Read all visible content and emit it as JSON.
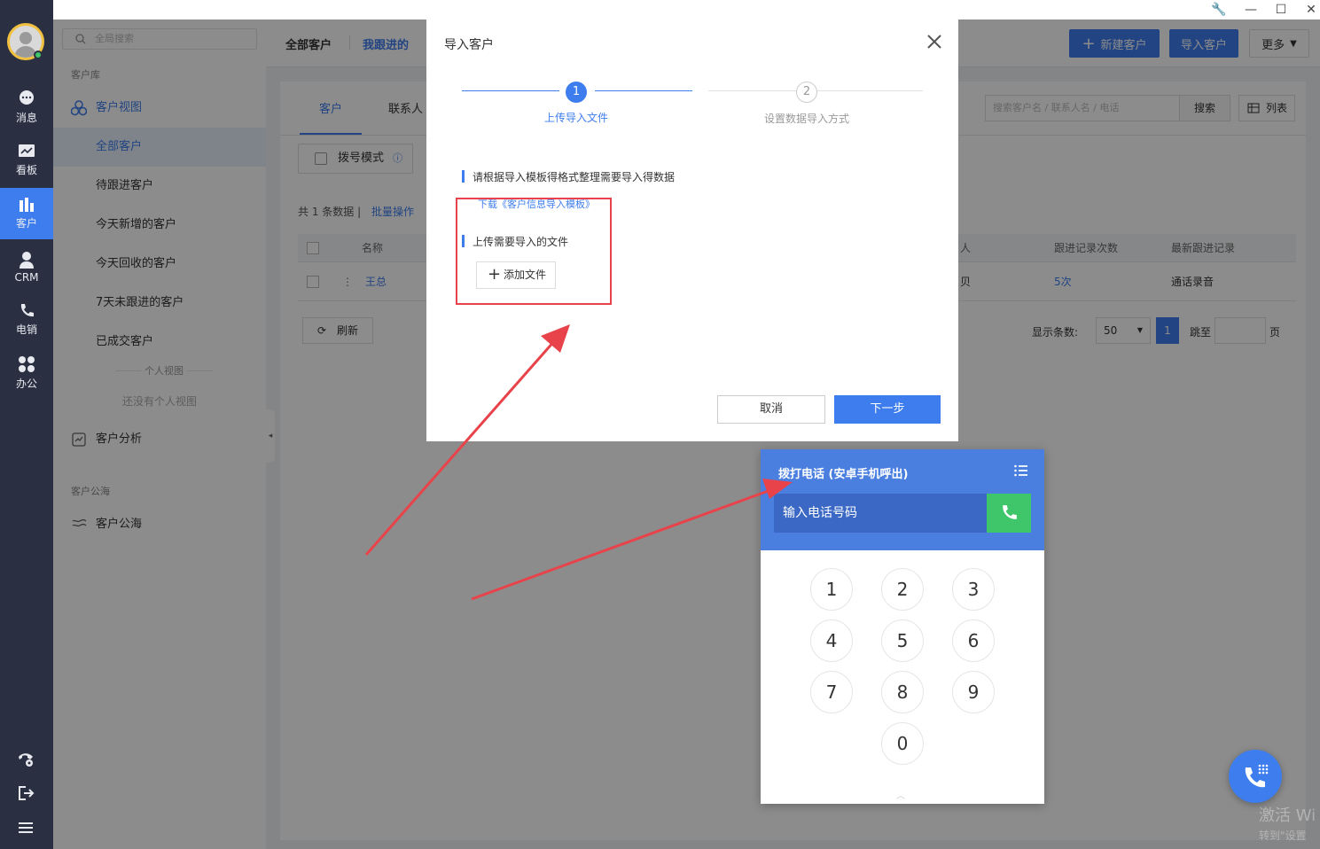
{
  "rail": {
    "items": [
      {
        "label": "消息",
        "icon": "message-icon"
      },
      {
        "label": "看板",
        "icon": "dashboard-icon"
      },
      {
        "label": "客户",
        "icon": "customer-icon"
      },
      {
        "label": "CRM",
        "icon": "crm-icon"
      },
      {
        "label": "电销",
        "icon": "phone-icon"
      },
      {
        "label": "办公",
        "icon": "apps-icon"
      }
    ],
    "active": "客户"
  },
  "sidebar": {
    "search_placeholder": "全局搜索",
    "group1": "客户库",
    "view_head": "客户视图",
    "items": [
      "全部客户",
      "待跟进客户",
      "今天新增的客户",
      "今天回收的客户",
      "7天未跟进的客户",
      "已成交客户"
    ],
    "personal_divider": "个人视图",
    "personal_empty": "还没有个人视图",
    "analysis": "客户分析",
    "group2": "客户公海",
    "sea": "客户公海"
  },
  "header": {
    "tab_all": "全部客户",
    "tab_mine": "我跟进的",
    "new_customer": "新建客户",
    "import_customer": "导入客户",
    "more": "更多"
  },
  "main": {
    "tabs": [
      "客户",
      "联系人"
    ],
    "dial_mode": "拨号模式",
    "count_text": "共 1 条数据",
    "batch": "批量操作",
    "search_placeholder": "搜索客户名 / 联系人名 / 电话",
    "search_btn": "搜索",
    "list_btn": "列表",
    "columns": [
      "名称",
      "人",
      "跟进记录次数",
      "最新跟进记录"
    ],
    "row": {
      "name": "王总",
      "owner": "贝",
      "count": "5次",
      "latest": "通话录音"
    },
    "refresh": "刷新",
    "page_size_label": "显示条数:",
    "page_size": "50",
    "page": "1",
    "goto": "跳至",
    "page_unit": "页"
  },
  "dialog": {
    "title": "导入客户",
    "step1_num": "1",
    "step1_label": "上传导入文件",
    "step2_num": "2",
    "step2_label": "设置数据导入方式",
    "instruction": "请根据导入模板得格式整理需要导入得数据",
    "template_link": "下载《客户信息导入模板》",
    "upload_label": "上传需要导入的文件",
    "add_file": "添加文件",
    "cancel": "取消",
    "next": "下一步"
  },
  "dialpad": {
    "title": "拨打电话 (安卓手机呼出)",
    "input_placeholder": "输入电话号码",
    "keys": [
      "1",
      "2",
      "3",
      "4",
      "5",
      "6",
      "7",
      "8",
      "9",
      "0"
    ]
  },
  "watermark": {
    "line1": "激活 Wi",
    "line2": "转到\"设置"
  },
  "colors": {
    "accent": "#3e7ded",
    "rail": "#2a3042",
    "highlight": "#e8434a",
    "call": "#3fc56a"
  }
}
